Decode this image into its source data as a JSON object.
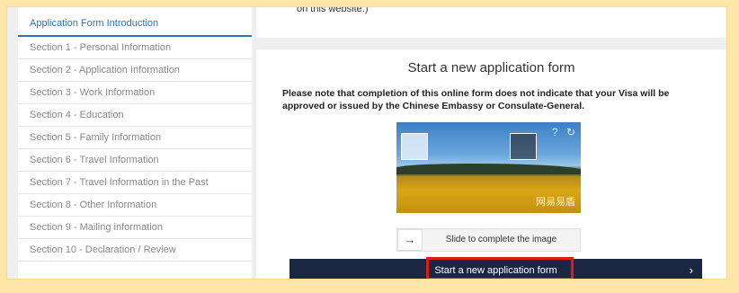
{
  "sidebar": {
    "items": [
      {
        "label": "Application Form Introduction",
        "active": true
      },
      {
        "label": "Section 1 - Personal Information"
      },
      {
        "label": "Section 2 - Application Information"
      },
      {
        "label": "Section 3 - Work Information"
      },
      {
        "label": "Section 4 - Education"
      },
      {
        "label": "Section 5 - Family Information"
      },
      {
        "label": "Section 6 - Travel Information"
      },
      {
        "label": "Section 7 - Travel Information in the Past"
      },
      {
        "label": "Section 8 - Other Information"
      },
      {
        "label": "Section 9 - Mailing information"
      },
      {
        "label": "Section 10 - Declaration / Review"
      }
    ]
  },
  "top_card": {
    "text": "on this website.)"
  },
  "main": {
    "title": "Start a new application form",
    "note": "Please note that completion of this online form does not indicate that your Visa will be approved or issued by the Chinese Embassy or Consulate-General.",
    "captcha": {
      "watermark": "网易易盾",
      "help_icon": "help-icon",
      "refresh_icon": "refresh-icon"
    },
    "slider": {
      "handle_glyph": "→",
      "text": "Slide to complete the image"
    },
    "start_button": {
      "label": "Start a new application form",
      "chevron": "›"
    }
  },
  "colors": {
    "accent": "#2b73b7",
    "button": "#1b2642",
    "highlight": "#e01a1a",
    "page_bg": "#fde6a8"
  }
}
